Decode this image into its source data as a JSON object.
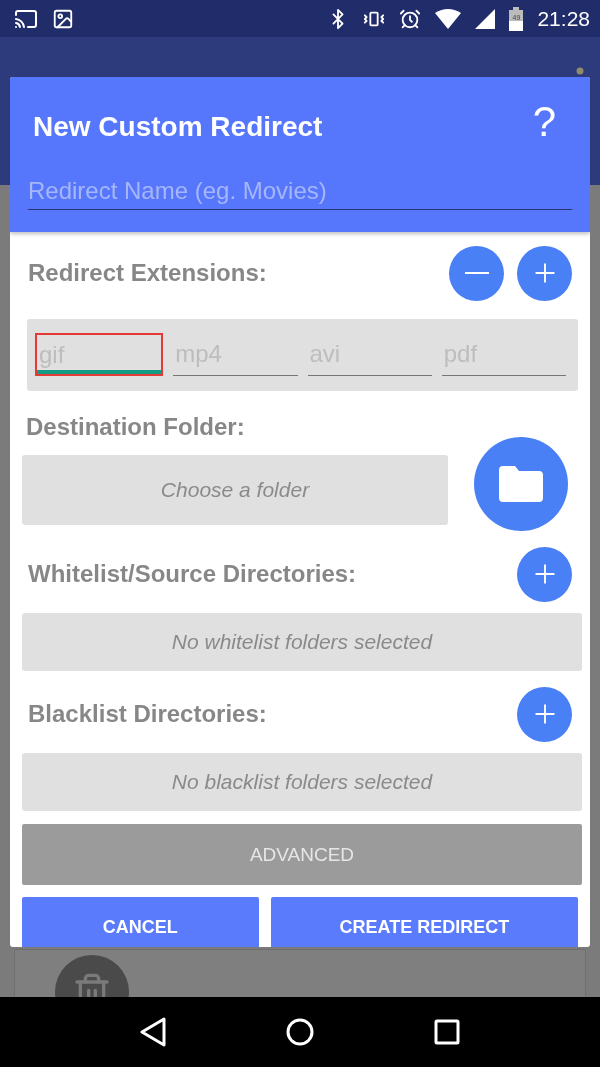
{
  "status_bar": {
    "time": "21:28",
    "battery": "49"
  },
  "dialog": {
    "title": "New Custom Redirect",
    "help": "?",
    "name_field": {
      "placeholder": "Redirect Name (eg. Movies)"
    },
    "extensions": {
      "label": "Redirect Extensions:",
      "fields": [
        {
          "placeholder": "gif",
          "focused": true
        },
        {
          "placeholder": "mp4",
          "focused": false
        },
        {
          "placeholder": "avi",
          "focused": false
        },
        {
          "placeholder": "pdf",
          "focused": false
        }
      ]
    },
    "destination": {
      "label": "Destination Folder:",
      "placeholder": "Choose a folder"
    },
    "directory_lists": [
      {
        "label": "Whitelist/Source Directories:",
        "empty_text": "No whitelist folders selected"
      },
      {
        "label": "Blacklist Directories:",
        "empty_text": "No blacklist folders selected"
      }
    ],
    "advanced_button": "ADVANCED",
    "buttons": [
      "CANCEL",
      "CREATE REDIRECT"
    ]
  }
}
